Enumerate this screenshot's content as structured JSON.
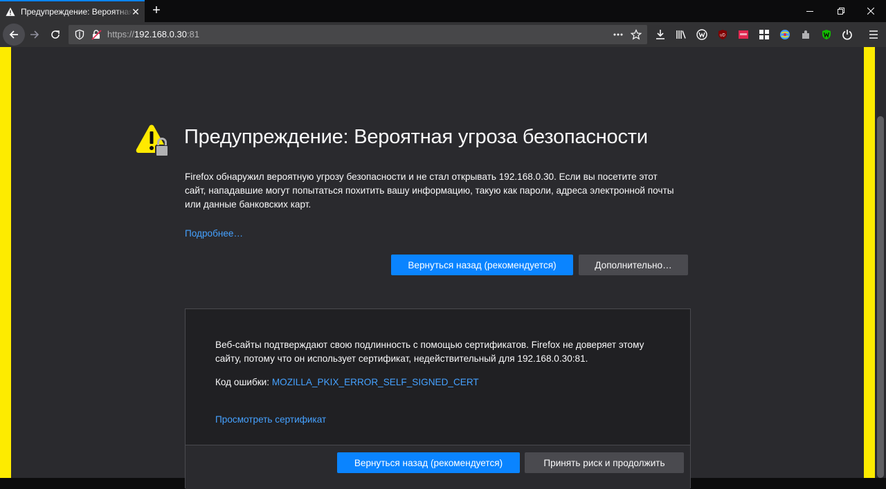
{
  "browser": {
    "tab": {
      "title": "Предупреждение: Вероятная угроза безопасности",
      "close_glyph": "✕",
      "icon": "warning-icon"
    },
    "new_tab_glyph": "+",
    "url": {
      "scheme": "https://",
      "host": "192.168.0.30",
      "port": ":81"
    },
    "toolbar_icons": [
      "back-icon",
      "forward-icon",
      "reload-icon",
      "tracking-shield-icon",
      "insecure-lock-icon",
      "page-actions-icon",
      "bookmark-star-icon",
      "downloads-icon",
      "library-icon",
      "extension-w-icon",
      "ublock-icon",
      "extension-red-icon",
      "extension-grid-icon",
      "extension-globe-icon",
      "extension-puzzle-icon",
      "extension-green-w-icon",
      "power-icon",
      "menu-icon"
    ]
  },
  "page": {
    "title": "Предупреждение: Вероятная угроза безопасности",
    "description": "Firefox обнаружил вероятную угрозу безопасности и не стал открывать 192.168.0.30. Если вы посетите этот сайт, нападавшие могут попытаться похитить вашу информацию, такую как пароли, адреса электронной почты или данные банковских карт.",
    "learn_more": "Подробнее…",
    "go_back_label": "Вернуться назад (рекомендуется)",
    "advanced_label": "Дополнительно…"
  },
  "advanced": {
    "text": "Веб-сайты подтверждают свою подлинность с помощью сертификатов. Firefox не доверяет этому сайту, потому что он использует сертификат, недействительный для 192.168.0.30:81.",
    "error_label": "Код ошибки: ",
    "error_code": "MOZILLA_PKIX_ERROR_SELF_SIGNED_CERT",
    "view_certificate": "Просмотреть сертификат",
    "go_back_label": "Вернуться назад (рекомендуется)",
    "accept_label": "Принять риск и продолжить"
  },
  "colors": {
    "accent": "#0a84ff",
    "link": "#45a1ff",
    "page_bg": "#2a2a2e",
    "border_frame": "#fdeb00",
    "warning": "#ffe900"
  }
}
